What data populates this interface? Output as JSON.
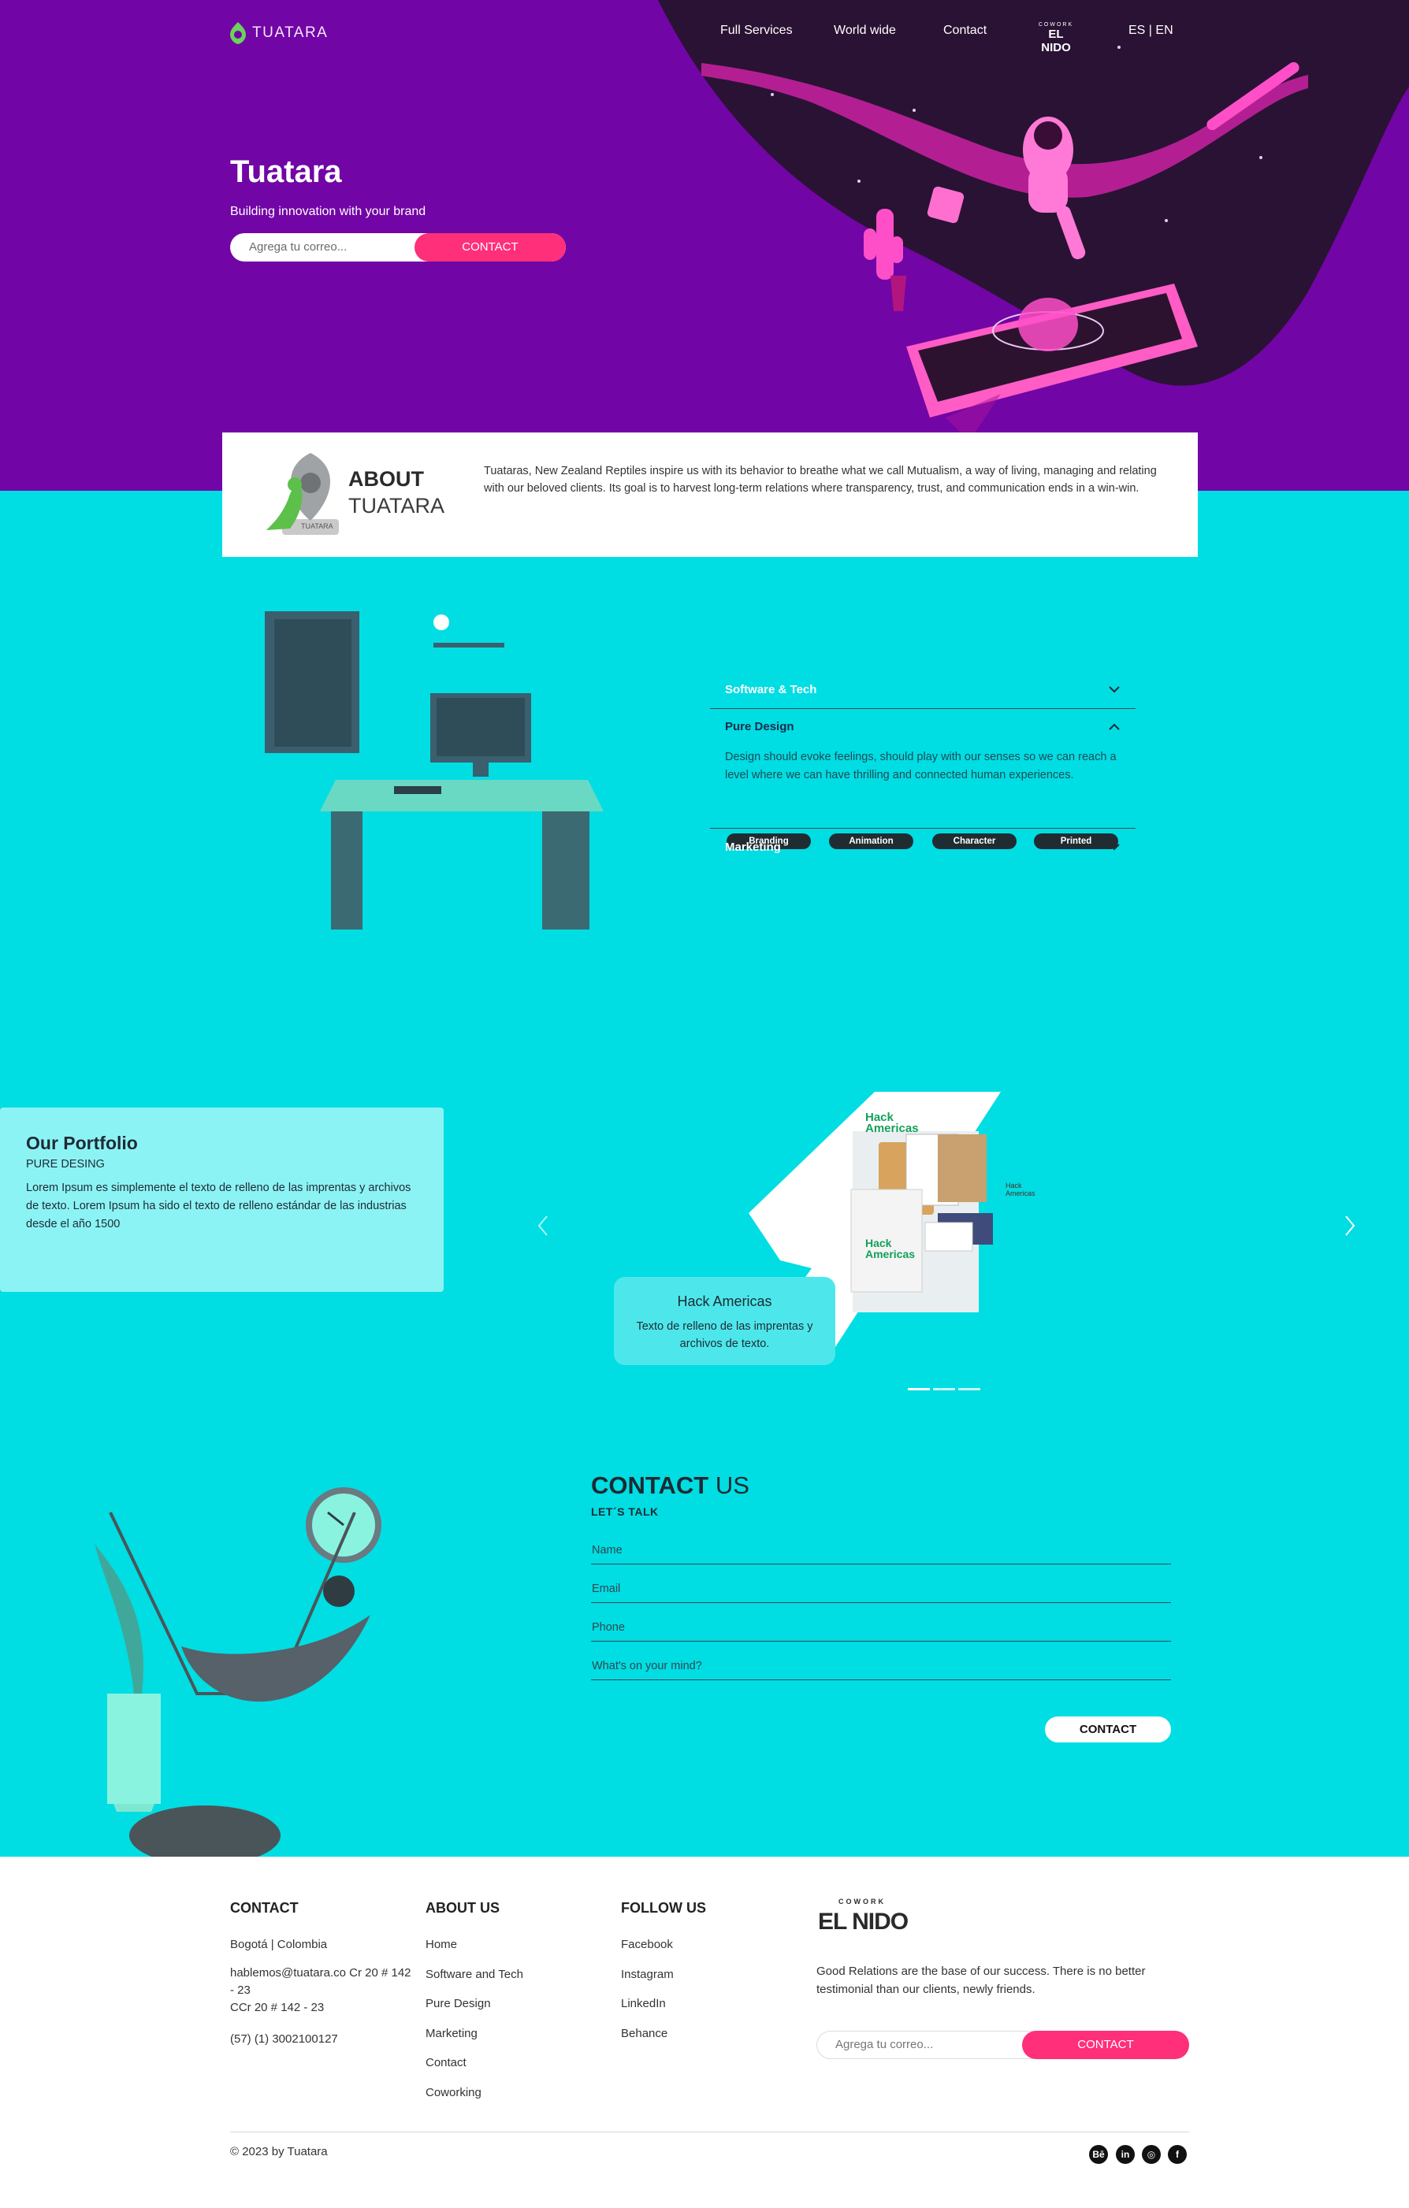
{
  "header": {
    "logo_text": "TUATARA",
    "nav": [
      "Full Services",
      "World wide",
      "Contact"
    ],
    "partner_logo": "EL NIDO",
    "partner_logo_small": "COWORK",
    "language": "ES | EN"
  },
  "hero": {
    "title": "Tuatara",
    "subtitle": "Building innovation with your brand",
    "email_placeholder": "Agrega tu correo...",
    "button": "CONTACT"
  },
  "about": {
    "title": "ABOUT",
    "subtitle": "TUATARA",
    "badge_text": "TUATARA",
    "text": "Tuataras, New Zealand Reptiles inspire us with its behavior to breathe what we call Mutualism, a way of living, managing and relating with our beloved clients. Its goal is to harvest long-term relations where transparency, trust, and communication ends in a win-win."
  },
  "services": {
    "items": [
      {
        "label": "Software & Tech",
        "open": false
      },
      {
        "label": "Pure Design",
        "open": true,
        "description": "Design should evoke feelings, should play with our senses so we can reach a level where we can have thrilling and connected human experiences.",
        "tags": [
          "Branding",
          "Animation",
          "Character",
          "Printed"
        ]
      },
      {
        "label": "Marketing",
        "open": false
      }
    ]
  },
  "portfolio": {
    "title": "Our Portfolio",
    "subtitle": "PURE DESING",
    "text": "Lorem Ipsum es simplemente el texto de relleno de las imprentas y archivos de texto. Lorem Ipsum ha sido el texto de relleno estándar de las industrias desde el año 1500",
    "slide": {
      "brand_line1": "Hack",
      "brand_line2": "Americas",
      "brand_small": "Hack Americas",
      "caption_title": "Hack Americas",
      "caption_text": "Texto de relleno de las imprentas y archivos de texto."
    },
    "dots": 3,
    "active_dot": 0
  },
  "contact": {
    "title_bold": "CONTACT",
    "title_light": " US",
    "subtitle": "LET´S TALK",
    "fields": [
      "Name",
      "Email",
      "Phone",
      "What's on your mind?"
    ],
    "button": "CONTACT"
  },
  "footer": {
    "contact": {
      "heading": "CONTACT",
      "lines": [
        "Bogotá | Colombia",
        "hablemos@tuatara.co Cr 20 # 142 - 23",
        "CCr 20 # 142 - 23",
        "(57) (1) 3002100127"
      ]
    },
    "about": {
      "heading": "ABOUT US",
      "links": [
        "Home",
        "Software and Tech",
        "Pure Design",
        "Marketing",
        "Contact",
        "Coworking"
      ]
    },
    "follow": {
      "heading": "FOLLOW US",
      "links": [
        "Facebook",
        "Instagram",
        "LinkedIn",
        "Behance"
      ]
    },
    "newsletter": {
      "logo": "EL NIDO",
      "logo_small": "COWORK",
      "text": "Good Relations are the base of our success. There is no better testimonial than our clients, newly friends.",
      "placeholder": "Agrega tu correo...",
      "button": "CONTACT"
    },
    "copyright": "© 2023 by Tuatara",
    "social": [
      "Bē",
      "in",
      "◎",
      "f"
    ],
    "social_names": [
      "behance-icon",
      "linkedin-icon",
      "instagram-icon",
      "facebook-icon"
    ]
  },
  "colors": {
    "hero_purple": "#7205a5",
    "space_dark": "#2a1234",
    "cyan": "#00dde3",
    "pink_button": "#ff2f7a",
    "card_light": "#8cf3f5"
  }
}
